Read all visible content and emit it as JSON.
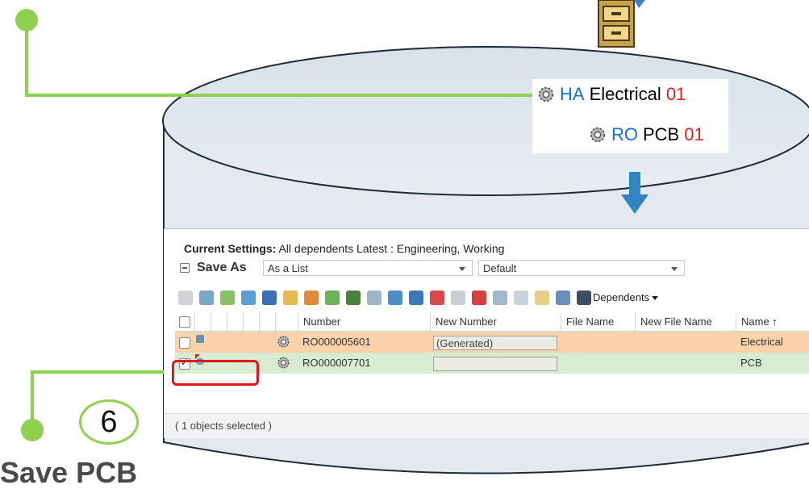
{
  "hierarchy": {
    "parent": {
      "prefix": "HA",
      "name": "Electrical",
      "revision": "01"
    },
    "child": {
      "prefix": "RO",
      "name": "PCB",
      "revision": "01"
    }
  },
  "panel": {
    "settings_label": "Current Settings:",
    "settings_value": "All dependents Latest : Engineering, Working",
    "save_as_label": "Save As",
    "save_as_select": "As a List",
    "view_select": "Default",
    "dependents_label": "Dependents",
    "columns": [
      "Number",
      "New Number",
      "File Name",
      "New File Name",
      "Name ↑"
    ],
    "rows": [
      {
        "number": "RO000005601",
        "new_number": "(Generated)",
        "name": "Electrical",
        "checked": false
      },
      {
        "number": "RO000007701",
        "new_number": "",
        "name": "PCB",
        "checked": true
      }
    ],
    "footer": "( 1 objects selected )"
  },
  "callout": {
    "step": "6",
    "caption": "Save PCB"
  },
  "colors": {
    "connector_green": "#8fd14f",
    "prefix_blue": "#1670d6",
    "revision_red": "#e61e1e",
    "highlight_red": "#e3141b",
    "arrow_blue": "#2f86c2",
    "cylinder_fill": "#e1e7ee",
    "row_orange": "#fbd3ab",
    "row_green": "#d8ecd2"
  }
}
